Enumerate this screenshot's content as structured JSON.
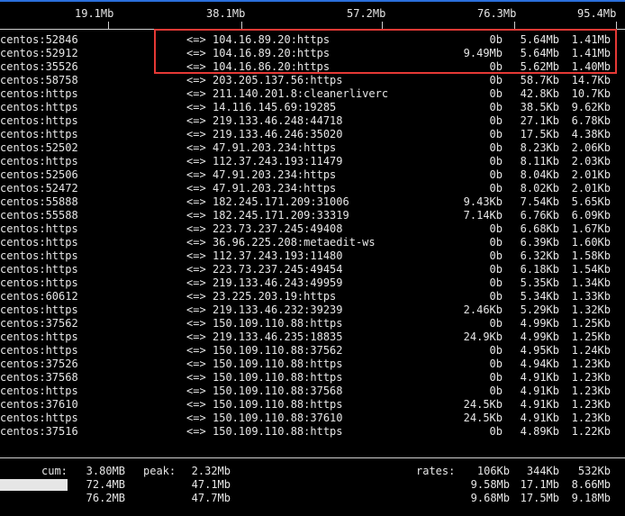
{
  "scale": {
    "ticks": [
      "19.1Mb",
      "38.1Mb",
      "57.2Mb",
      "76.3Mb",
      "95.4Mb"
    ]
  },
  "connections": [
    {
      "src": "centos:52846",
      "dir": "<=>",
      "dst": "104.16.89.20:https",
      "r2s": "0b",
      "r10s": "5.64Mb",
      "r40s": "1.41Mb"
    },
    {
      "src": "centos:52912",
      "dir": "<=>",
      "dst": "104.16.89.20:https",
      "r2s": "9.49Mb",
      "r10s": "5.64Mb",
      "r40s": "1.41Mb"
    },
    {
      "src": "centos:35526",
      "dir": "<=>",
      "dst": "104.16.86.20:https",
      "r2s": "0b",
      "r10s": "5.62Mb",
      "r40s": "1.40Mb"
    },
    {
      "src": "centos:58758",
      "dir": "<=>",
      "dst": "203.205.137.56:https",
      "r2s": "0b",
      "r10s": "58.7Kb",
      "r40s": "14.7Kb"
    },
    {
      "src": "centos:https",
      "dir": "<=>",
      "dst": "211.140.201.8:cleanerliverc",
      "r2s": "0b",
      "r10s": "42.8Kb",
      "r40s": "10.7Kb"
    },
    {
      "src": "centos:https",
      "dir": "<=>",
      "dst": "14.116.145.69:19285",
      "r2s": "0b",
      "r10s": "38.5Kb",
      "r40s": "9.62Kb"
    },
    {
      "src": "centos:https",
      "dir": "<=>",
      "dst": "219.133.46.248:44718",
      "r2s": "0b",
      "r10s": "27.1Kb",
      "r40s": "6.78Kb"
    },
    {
      "src": "centos:https",
      "dir": "<=>",
      "dst": "219.133.46.246:35020",
      "r2s": "0b",
      "r10s": "17.5Kb",
      "r40s": "4.38Kb"
    },
    {
      "src": "centos:52502",
      "dir": "<=>",
      "dst": "47.91.203.234:https",
      "r2s": "0b",
      "r10s": "8.23Kb",
      "r40s": "2.06Kb"
    },
    {
      "src": "centos:https",
      "dir": "<=>",
      "dst": "112.37.243.193:11479",
      "r2s": "0b",
      "r10s": "8.11Kb",
      "r40s": "2.03Kb"
    },
    {
      "src": "centos:52506",
      "dir": "<=>",
      "dst": "47.91.203.234:https",
      "r2s": "0b",
      "r10s": "8.04Kb",
      "r40s": "2.01Kb"
    },
    {
      "src": "centos:52472",
      "dir": "<=>",
      "dst": "47.91.203.234:https",
      "r2s": "0b",
      "r10s": "8.02Kb",
      "r40s": "2.01Kb"
    },
    {
      "src": "centos:55888",
      "dir": "<=>",
      "dst": "182.245.171.209:31006",
      "r2s": "9.43Kb",
      "r10s": "7.54Kb",
      "r40s": "5.65Kb"
    },
    {
      "src": "centos:55588",
      "dir": "<=>",
      "dst": "182.245.171.209:33319",
      "r2s": "7.14Kb",
      "r10s": "6.76Kb",
      "r40s": "6.09Kb"
    },
    {
      "src": "centos:https",
      "dir": "<=>",
      "dst": "223.73.237.245:49408",
      "r2s": "0b",
      "r10s": "6.68Kb",
      "r40s": "1.67Kb"
    },
    {
      "src": "centos:https",
      "dir": "<=>",
      "dst": "36.96.225.208:metaedit-ws",
      "r2s": "0b",
      "r10s": "6.39Kb",
      "r40s": "1.60Kb"
    },
    {
      "src": "centos:https",
      "dir": "<=>",
      "dst": "112.37.243.193:11480",
      "r2s": "0b",
      "r10s": "6.32Kb",
      "r40s": "1.58Kb"
    },
    {
      "src": "centos:https",
      "dir": "<=>",
      "dst": "223.73.237.245:49454",
      "r2s": "0b",
      "r10s": "6.18Kb",
      "r40s": "1.54Kb"
    },
    {
      "src": "centos:https",
      "dir": "<=>",
      "dst": "219.133.46.243:49959",
      "r2s": "0b",
      "r10s": "5.35Kb",
      "r40s": "1.34Kb"
    },
    {
      "src": "centos:60612",
      "dir": "<=>",
      "dst": "23.225.203.19:https",
      "r2s": "0b",
      "r10s": "5.34Kb",
      "r40s": "1.33Kb"
    },
    {
      "src": "centos:https",
      "dir": "<=>",
      "dst": "219.133.46.232:39239",
      "r2s": "2.46Kb",
      "r10s": "5.29Kb",
      "r40s": "1.32Kb"
    },
    {
      "src": "centos:37562",
      "dir": "<=>",
      "dst": "150.109.110.88:https",
      "r2s": "0b",
      "r10s": "4.99Kb",
      "r40s": "1.25Kb"
    },
    {
      "src": "centos:https",
      "dir": "<=>",
      "dst": "219.133.46.235:18835",
      "r2s": "24.9Kb",
      "r10s": "4.99Kb",
      "r40s": "1.25Kb"
    },
    {
      "src": "centos:https",
      "dir": "<=>",
      "dst": "150.109.110.88:37562",
      "r2s": "0b",
      "r10s": "4.95Kb",
      "r40s": "1.24Kb"
    },
    {
      "src": "centos:37526",
      "dir": "<=>",
      "dst": "150.109.110.88:https",
      "r2s": "0b",
      "r10s": "4.94Kb",
      "r40s": "1.23Kb"
    },
    {
      "src": "centos:37568",
      "dir": "<=>",
      "dst": "150.109.110.88:https",
      "r2s": "0b",
      "r10s": "4.91Kb",
      "r40s": "1.23Kb"
    },
    {
      "src": "centos:https",
      "dir": "<=>",
      "dst": "150.109.110.88:37568",
      "r2s": "0b",
      "r10s": "4.91Kb",
      "r40s": "1.23Kb"
    },
    {
      "src": "centos:37610",
      "dir": "<=>",
      "dst": "150.109.110.88:https",
      "r2s": "24.5Kb",
      "r10s": "4.91Kb",
      "r40s": "1.23Kb"
    },
    {
      "src": "centos:https",
      "dir": "<=>",
      "dst": "150.109.110.88:37610",
      "r2s": "24.5Kb",
      "r10s": "4.91Kb",
      "r40s": "1.23Kb"
    },
    {
      "src": "centos:37516",
      "dir": "<=>",
      "dst": "150.109.110.88:https",
      "r2s": "0b",
      "r10s": "4.89Kb",
      "r40s": "1.22Kb"
    }
  ],
  "footer": {
    "cum_label": "cum:",
    "peak_label": "peak:",
    "rates_label": "rates:",
    "rows": [
      {
        "cum": "3.80MB",
        "peak": "2.32Mb",
        "r2s": "106Kb",
        "r10s": "344Kb",
        "r40s": "532Kb"
      },
      {
        "cum": "72.4MB",
        "peak": "47.1Mb",
        "r2s": "9.58Mb",
        "r10s": "17.1Mb",
        "r40s": "8.66Mb"
      },
      {
        "cum": "76.2MB",
        "peak": "47.7Mb",
        "r2s": "9.68Mb",
        "r10s": "17.5Mb",
        "r40s": "9.18Mb"
      }
    ]
  },
  "colors": {
    "highlight_box": "#e53935",
    "top_border": "#2a6fdb"
  }
}
